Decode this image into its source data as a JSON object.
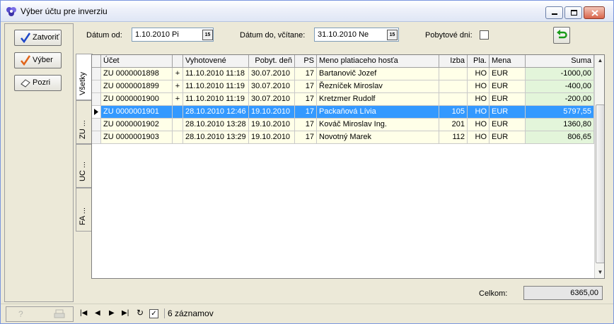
{
  "window": {
    "title": "Výber účtu pre inverziu"
  },
  "left_buttons": {
    "close_label": "Zatvoriť",
    "select_label": "Výber",
    "view_label": "Pozri"
  },
  "tabs": [
    {
      "label": "Všetky"
    },
    {
      "label": "ZU ..."
    },
    {
      "label": "UC ..."
    },
    {
      "label": "FA ..."
    }
  ],
  "filters": {
    "date_from_label": "Dátum od:",
    "date_from_value": "1.10.2010  Pi",
    "date_to_label": "Dátum do, včítane:",
    "date_to_value": "31.10.2010  Ne",
    "stay_days_label": "Pobytové dni:",
    "calendar_glyph": "15"
  },
  "grid": {
    "columns": [
      "Účet",
      "",
      "Vyhotovené",
      "Pobyt. deň",
      "PS",
      "Meno platiaceho hosťa",
      "Izba",
      "Pla.",
      "Mena",
      "Suma"
    ],
    "rows": [
      {
        "account": "ZU 0000001898",
        "flag": "+",
        "created": "11.10.2010 11:18",
        "stay_day": "30.07.2010",
        "ps": "17",
        "guest": "Bartanovič Jozef",
        "room": "",
        "pay": "HO",
        "currency": "EUR",
        "amount": "-1000,00"
      },
      {
        "account": "ZU 0000001899",
        "flag": "+",
        "created": "11.10.2010 11:19",
        "stay_day": "30.07.2010",
        "ps": "17",
        "guest": "Řezníček Miroslav",
        "room": "",
        "pay": "HO",
        "currency": "EUR",
        "amount": "-400,00"
      },
      {
        "account": "ZU 0000001900",
        "flag": "+",
        "created": "11.10.2010 11:19",
        "stay_day": "30.07.2010",
        "ps": "17",
        "guest": "Kretzmer Rudolf",
        "room": "",
        "pay": "HO",
        "currency": "EUR",
        "amount": "-200,00"
      },
      {
        "account": "ZU 0000001901",
        "flag": "",
        "created": "28.10.2010 12:46",
        "stay_day": "19.10.2010",
        "ps": "17",
        "guest": "Packaňová  Lívia",
        "room": "105",
        "pay": "HO",
        "currency": "EUR",
        "amount": "5797,55"
      },
      {
        "account": "ZU 0000001902",
        "flag": "",
        "created": "28.10.2010 13:28",
        "stay_day": "19.10.2010",
        "ps": "17",
        "guest": "Kováč Miroslav Ing.",
        "room": "201",
        "pay": "HO",
        "currency": "EUR",
        "amount": "1360,80"
      },
      {
        "account": "ZU 0000001903",
        "flag": "",
        "created": "28.10.2010 13:29",
        "stay_day": "19.10.2010",
        "ps": "17",
        "guest": "Novotný  Marek",
        "room": "112",
        "pay": "HO",
        "currency": "EUR",
        "amount": "806,65"
      }
    ],
    "selected_row": 3
  },
  "total": {
    "label": "Celkom:",
    "value": "6365,00"
  },
  "status": {
    "records": "6 záznamov"
  },
  "colors": {
    "selection": "#3399ff",
    "row_highlight": "#ffffe8",
    "amount_bg": "#e3f5da"
  }
}
